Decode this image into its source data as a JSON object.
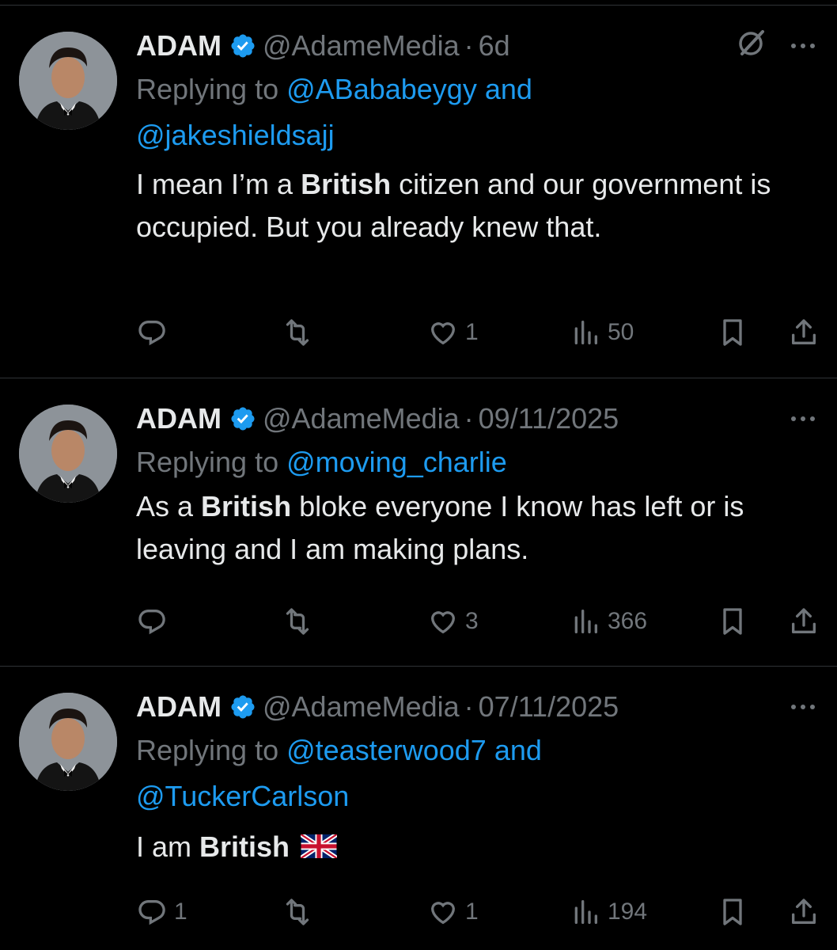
{
  "tweets": [
    {
      "name": "ADAM",
      "handle": "@AdameMedia",
      "time": "6d",
      "reply_prefix": "Replying to",
      "mentions_line1": "@ABababeygy and",
      "mentions_line2": "@jakeshieldsajj",
      "text_pre": "I mean I’m a ",
      "text_bold": "British",
      "text_post": " citizen and our government is occupied.  But you already knew that.",
      "replies": "",
      "retweets": "",
      "likes": "1",
      "views": "50",
      "has_grok_icon": true
    },
    {
      "name": "ADAM",
      "handle": "@AdameMedia",
      "time": "09/11/2025",
      "reply_prefix": "Replying to",
      "mentions_line1": "@moving_charlie",
      "mentions_line2": "",
      "text_pre": "As a ",
      "text_bold": "British",
      "text_post": " bloke everyone I know has left or is leaving and I am making plans.",
      "replies": "",
      "retweets": "",
      "likes": "3",
      "views": "366",
      "has_grok_icon": false
    },
    {
      "name": "ADAM",
      "handle": "@AdameMedia",
      "time": "07/11/2025",
      "reply_prefix": "Replying to",
      "mentions_line1": "@teasterwood7 and",
      "mentions_line2": "@TuckerCarlson",
      "text_pre": "I am ",
      "text_bold": "British",
      "text_post": "",
      "replies": "1",
      "retweets": "",
      "likes": "1",
      "views": "194",
      "has_grok_icon": false
    }
  ],
  "colors": {
    "background": "#000000",
    "text": "#e7e9ea",
    "muted": "#71767b",
    "link": "#1d9bf0",
    "divider": "#2f3336"
  },
  "icons": [
    "verified-badge-icon",
    "grok-icon",
    "more-icon",
    "reply-icon",
    "retweet-icon",
    "like-icon",
    "views-icon",
    "bookmark-icon",
    "share-icon",
    "uk-flag-emoji"
  ]
}
